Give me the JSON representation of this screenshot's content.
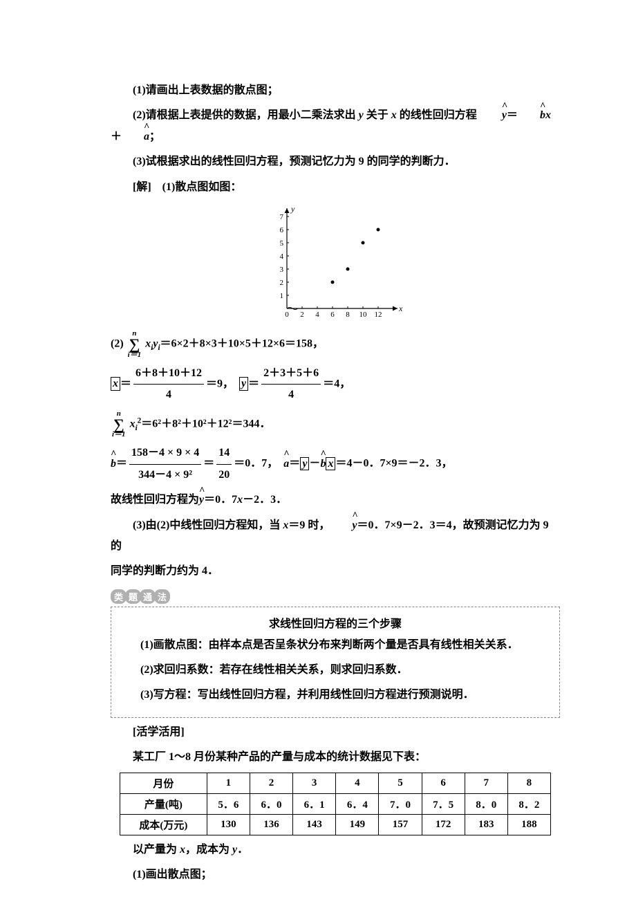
{
  "q1": "(1)请画出上表数据的散点图；",
  "q2_a": "(2)请根据上表提供的数据，用最小二乘法求出 ",
  "q2_y": "y",
  "q2_mid": " 关于 ",
  "q2_x": "x",
  "q2_b": " 的线性回归方程  ",
  "q2_eq_y": "y",
  "q2_eq_eq": "＝",
  "q2_eq_b": "b",
  "q2_eq_x": "x",
  "q2_eq_plus": "＋",
  "q2_eq_a": "a",
  "q2_end": "；",
  "q3": "(3)试根据求出的线性回归方程，预测记忆力为 9 的同学的判断力．",
  "sol_head": "[解]　(1)散点图如图：",
  "chart_data": {
    "type": "scatter",
    "xlabel": "x",
    "ylabel": "y",
    "x_ticks": [
      0,
      2,
      4,
      6,
      8,
      10,
      12
    ],
    "y_ticks": [
      1,
      2,
      3,
      4,
      5,
      6,
      7
    ],
    "points": [
      [
        6,
        2
      ],
      [
        8,
        3
      ],
      [
        10,
        5
      ],
      [
        12,
        6
      ]
    ],
    "xlim": [
      0,
      13.5
    ],
    "ylim": [
      0,
      7.5
    ]
  },
  "eq2_pre": "(2) ",
  "sum_top": "n",
  "sum_bot": "i＝1",
  "eq2_var": "x",
  "eq2_sub": "i",
  "eq2_var2": "y",
  "eq2_sub2": "i",
  "eq2_body": "＝6×2＋8×3＋10×5＋12×6＝158，",
  "xbar_num": "6＋8＋10＋12",
  "xbar_den": "4",
  "xbar_eq": "＝9，",
  "ybar_num": "2＋3＋5＋6",
  "ybar_den": "4",
  "ybar_eq": "＝4，",
  "x_sym": "x",
  "y_sym": "y",
  "sumx2_body": "＝6²＋8²＋10²＋12²＝344．",
  "x2_var": "x",
  "x2_sub": "i",
  "x2_sup": "2",
  "bhat": "b",
  "bhat_num": "158－4 × 9 × 4",
  "bhat_den": "344－4 × 9²",
  "bhat_mid": "＝",
  "bhat_num2": "14",
  "bhat_den2": "20",
  "bhat_val": "＝0．7，",
  "ahat": "a",
  "ahat_eq": "＝",
  "ahat_body": "＝4－0．7×9＝－2．3，",
  "reg_line_a": "故线性回归方程为",
  "reg_y": "y",
  "reg_line_b": "＝0．7",
  "reg_x": "x",
  "reg_line_c": "－2．3．",
  "p3a": "(3)由(2)中线性回归方程知，当 ",
  "p3x": "x",
  "p3b": "＝9 时，",
  "p3y": "y",
  "p3c": "＝0．7×9－2．3＝4，故预测记忆力为 9 的",
  "p3d": "同学的判断力约为 4．",
  "badge1": "类",
  "badge2": "题",
  "badge3": "通",
  "badge4": "法",
  "box_title": "求线性回归方程的三个步骤",
  "box1": "(1)画散点图：由样本点是否呈条状分布来判断两个量是否具有线性相关关系．",
  "box2": "(2)求回归系数：若存在线性相关关系，则求回归系数．",
  "box3": "(3)写方程：写出线性回归方程，并利用线性回归方程进行预测说明．",
  "apply": "[活学活用]",
  "apply_intro": "某工厂 1～8 月份某种产品的产量与成本的统计数据见下表：",
  "table": {
    "headers": [
      "月份",
      "1",
      "2",
      "3",
      "4",
      "5",
      "6",
      "7",
      "8"
    ],
    "row1_label": "产量(吨)",
    "row1": [
      "5．6",
      "6．0",
      "6．1",
      "6．4",
      "7．0",
      "7．5",
      "8．0",
      "8．2"
    ],
    "row2_label": "成本(万元)",
    "row2": [
      "130",
      "136",
      "143",
      "149",
      "157",
      "172",
      "183",
      "188"
    ]
  },
  "after_table_a": "以产量为 ",
  "after_table_x": "x",
  "after_table_b": "，成本为 ",
  "after_table_y": "y",
  "after_table_c": "．",
  "last": "(1)画出散点图；"
}
